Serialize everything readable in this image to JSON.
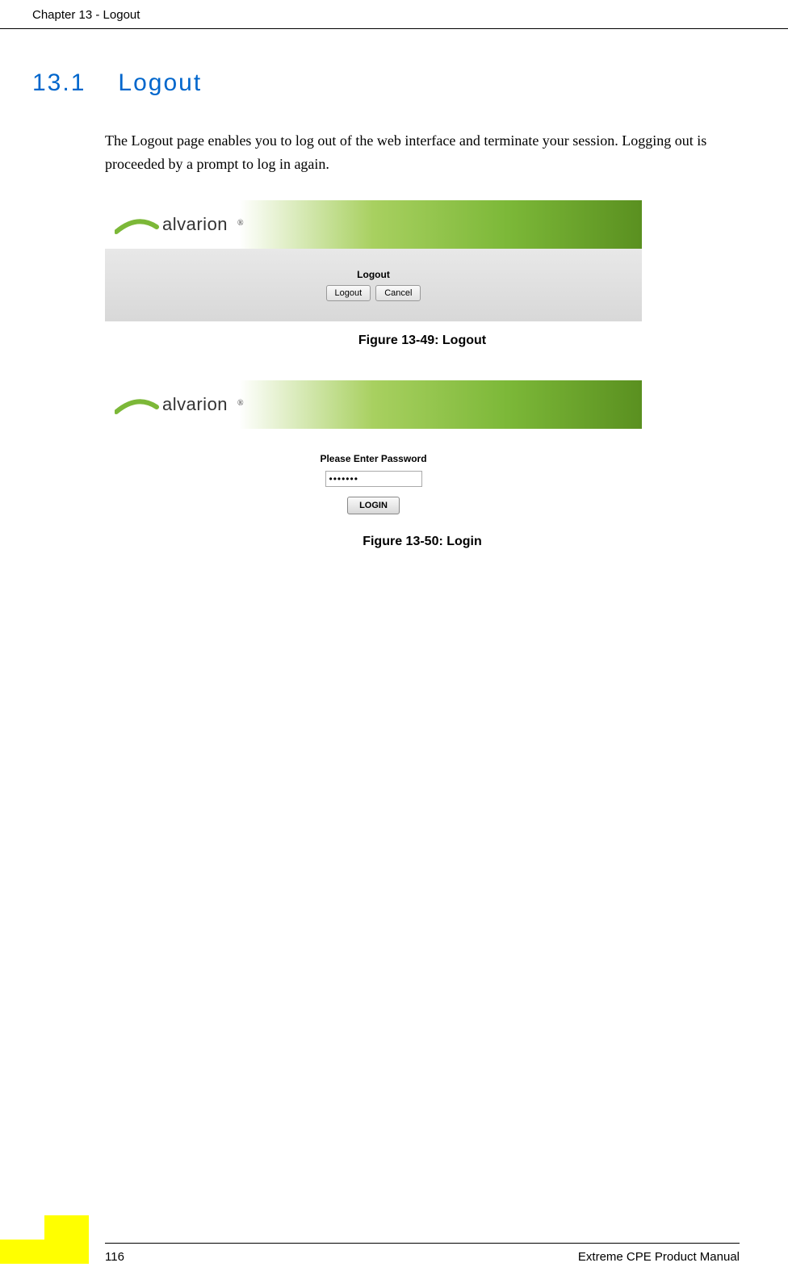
{
  "header": {
    "text": "Chapter 13 - Logout"
  },
  "section": {
    "number": "13.1",
    "title": "Logout"
  },
  "body_paragraph": "The Logout page enables you to log out of the web interface and terminate your session. Logging out is proceeded by a prompt to log in again.",
  "figure1": {
    "logo_text": "alvarion",
    "logo_reg": "®",
    "panel_title": "Logout",
    "logout_button": "Logout",
    "cancel_button": "Cancel",
    "caption": "Figure 13-49: Logout"
  },
  "figure2": {
    "logo_text": "alvarion",
    "logo_reg": "®",
    "prompt_title": "Please Enter Password",
    "password_value": "•••••••",
    "login_button": "LOGIN",
    "caption": "Figure 13-50: Login"
  },
  "footer": {
    "page_number": "116",
    "manual_title": "Extreme CPE Product Manual"
  }
}
